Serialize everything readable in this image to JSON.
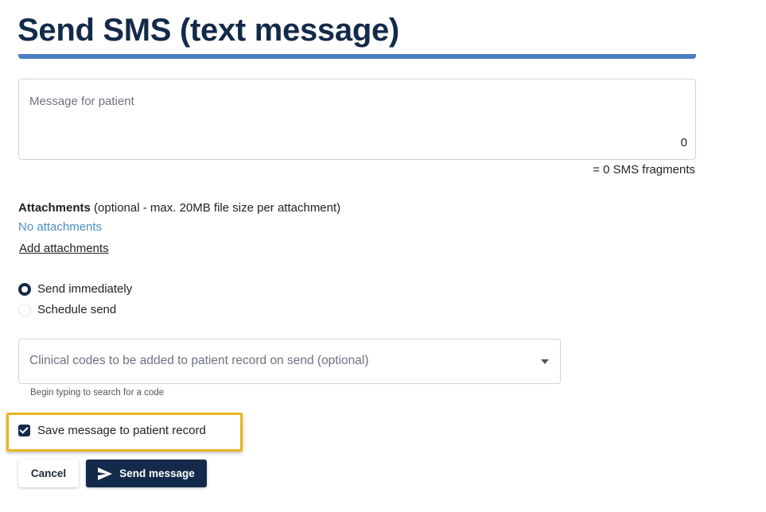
{
  "page": {
    "title": "Send SMS (text message)"
  },
  "message": {
    "placeholder": "Message for patient",
    "char_count": "0",
    "fragments_text": "= 0 SMS fragments"
  },
  "attachments": {
    "label": "Attachments",
    "note": " (optional - max. 20MB file size per attachment)",
    "empty_text": "No attachments",
    "add_link": "Add attachments"
  },
  "send_options": {
    "immediately_label": "Send immediately",
    "schedule_label": "Schedule send",
    "selected": "immediately"
  },
  "clinical_codes": {
    "placeholder": "Clinical codes to be added to patient record on send (optional)",
    "hint": "Begin typing to search for a code"
  },
  "save_record": {
    "label": "Save message to patient record",
    "checked": true
  },
  "buttons": {
    "cancel": "Cancel",
    "send": "Send message"
  },
  "colors": {
    "primary": "#142a4a",
    "accent_bar": "#4a7fc1",
    "link_blue": "#4a8fbf",
    "highlight": "#e8b422"
  },
  "icons": {
    "send": "send-icon",
    "dropdown": "chevron-down-icon",
    "checkbox": "check-icon"
  }
}
